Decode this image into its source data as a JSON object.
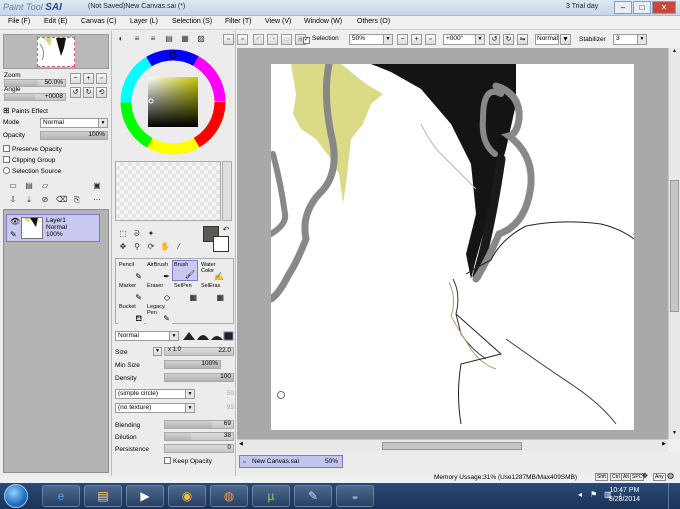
{
  "titlebar": {
    "logo_prefix": "Paint Tool",
    "logo_name": "SAI",
    "title": "(Not Saved)New Canvas.sai (*)",
    "trial": "3 Trial day",
    "min": "–",
    "max": "□",
    "close": "✕"
  },
  "menu": [
    "File (F)",
    "Edit (E)",
    "Canvas (C)",
    "Layer (L)",
    "Selection (S)",
    "Filter (T)",
    "View (V)",
    "Window (W)",
    "Others (O)"
  ],
  "navigator": {
    "zoom_label": "Zoom",
    "zoom_value": "50.0%",
    "angle_label": "Angle",
    "angle_value": "+0008"
  },
  "layer_panel": {
    "paints_effect": "Paints Effect",
    "mode_label": "Mode",
    "mode_value": "Normal",
    "opacity_label": "Opacity",
    "opacity_value": "100%",
    "opacity_level": 1.0,
    "preserve_opacity": "Preserve Opacity",
    "clipping_group": "Clipping Group",
    "selection_source": "Selection Source",
    "layers": [
      {
        "name": "Layer1",
        "mode": "Normal",
        "opacity": "100%"
      }
    ]
  },
  "tools": [
    {
      "label": "Pencil",
      "glyph": "✎"
    },
    {
      "label": "AirBrush",
      "glyph": "✒"
    },
    {
      "label": "Brush",
      "glyph": "🖌",
      "active": true
    },
    {
      "label": "Water Color",
      "glyph": "✍"
    },
    {
      "label": "Marker",
      "glyph": "✎"
    },
    {
      "label": "Eraser",
      "glyph": "◇"
    },
    {
      "label": "SelPen",
      "glyph": "▦"
    },
    {
      "label": "SelEras",
      "glyph": "▦"
    },
    {
      "label": "Bucket",
      "glyph": "⛾"
    },
    {
      "label": "Legacy Pen",
      "glyph": "✎"
    }
  ],
  "brush": {
    "blend_mode": "Normal",
    "size_label": "Size",
    "size_multiplier": "x 1.0",
    "size_value": "22.0",
    "min_size_label": "Min Size",
    "min_size_value": "100%",
    "density_label": "Density",
    "density_value": "100",
    "shape": "(simple circle)",
    "shape_value": "50",
    "texture": "(no texture)",
    "texture_value": "95",
    "blending_label": "Blending",
    "blending_value": "69",
    "dilution_label": "Dilution",
    "dilution_value": "38",
    "persistence_label": "Persistence",
    "persistence_value": "0",
    "keep_opacity": "Keep Opacity"
  },
  "toolbar": {
    "selection_label": "Selection",
    "zoom": "50%",
    "rotation": "+000°",
    "mode": "Normal",
    "stabilizer_label": "Stabilizer",
    "stabilizer_value": "3"
  },
  "document_tab": {
    "name": "New Canvas.sai",
    "zoom": "50%"
  },
  "status": {
    "memory": "Memory Ussage:31% (Use1287MB/Max409SMB)",
    "keys": [
      "Shft",
      "Ctrl",
      "Alt",
      "SPC",
      "Any"
    ]
  },
  "taskbar": {
    "time": "10:47 PM",
    "date": "8/28/2014"
  },
  "colors": {
    "primary": "#5a5a50",
    "secondary": "#ffffff",
    "accent": "#c4c4ef",
    "hair_blonde": "#d6d67a"
  }
}
